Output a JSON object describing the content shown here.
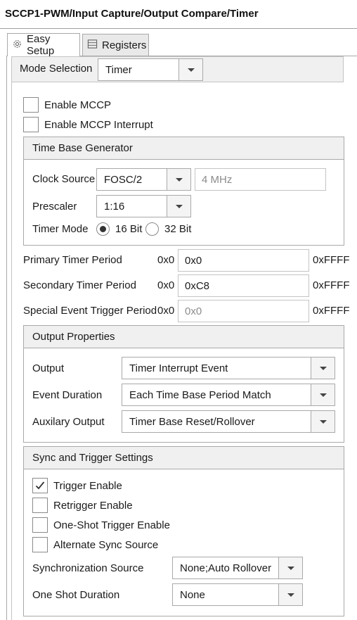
{
  "window": {
    "title": "SCCP1-PWM/Input Capture/Output Compare/Timer"
  },
  "tabs": [
    {
      "label": "Easy Setup",
      "icon": "gear-icon"
    },
    {
      "label": "Registers",
      "icon": "list-icon"
    }
  ],
  "mode": {
    "label": "Mode Selection",
    "value": "Timer"
  },
  "enable_mccp": {
    "label": "Enable MCCP",
    "checked": false
  },
  "enable_mccp_interrupt": {
    "label": "Enable MCCP Interrupt",
    "checked": false
  },
  "time_base": {
    "header": "Time Base Generator",
    "clock_source": {
      "label": "Clock Source",
      "value": "FOSC/2",
      "freq": "4 MHz"
    },
    "prescaler": {
      "label": "Prescaler",
      "value": "1:16"
    },
    "timer_mode": {
      "label": "Timer Mode",
      "options": [
        "16 Bit",
        "32 Bit"
      ],
      "selected": "16 Bit"
    }
  },
  "periods": [
    {
      "label": "Primary Timer Period",
      "min": "0x0",
      "value": "0x0",
      "max": "0xFFFF",
      "disabled": false
    },
    {
      "label": "Secondary Timer Period",
      "min": "0x0",
      "value": "0xC8",
      "max": "0xFFFF",
      "disabled": false
    },
    {
      "label": "Special Event Trigger Period",
      "min": "0x0",
      "value": "0x0",
      "max": "0xFFFF",
      "disabled": true
    }
  ],
  "output_props": {
    "header": "Output Properties",
    "rows": [
      {
        "label": "Output",
        "value": "Timer Interrupt Event"
      },
      {
        "label": "Event Duration",
        "value": "Each Time Base Period Match"
      },
      {
        "label": "Auxilary Output",
        "value": "Timer Base Reset/Rollover"
      }
    ]
  },
  "sync": {
    "header": "Sync and Trigger Settings",
    "checks": [
      {
        "label": "Trigger Enable",
        "checked": true
      },
      {
        "label": "Retrigger Enable",
        "checked": false
      },
      {
        "label": "One-Shot Trigger Enable",
        "checked": false
      },
      {
        "label": "Alternate Sync Source",
        "checked": false
      }
    ],
    "sync_source": {
      "label": "Synchronization Source",
      "value": "None;Auto Rollover"
    },
    "one_shot": {
      "label": "One Shot Duration",
      "value": "None"
    }
  }
}
